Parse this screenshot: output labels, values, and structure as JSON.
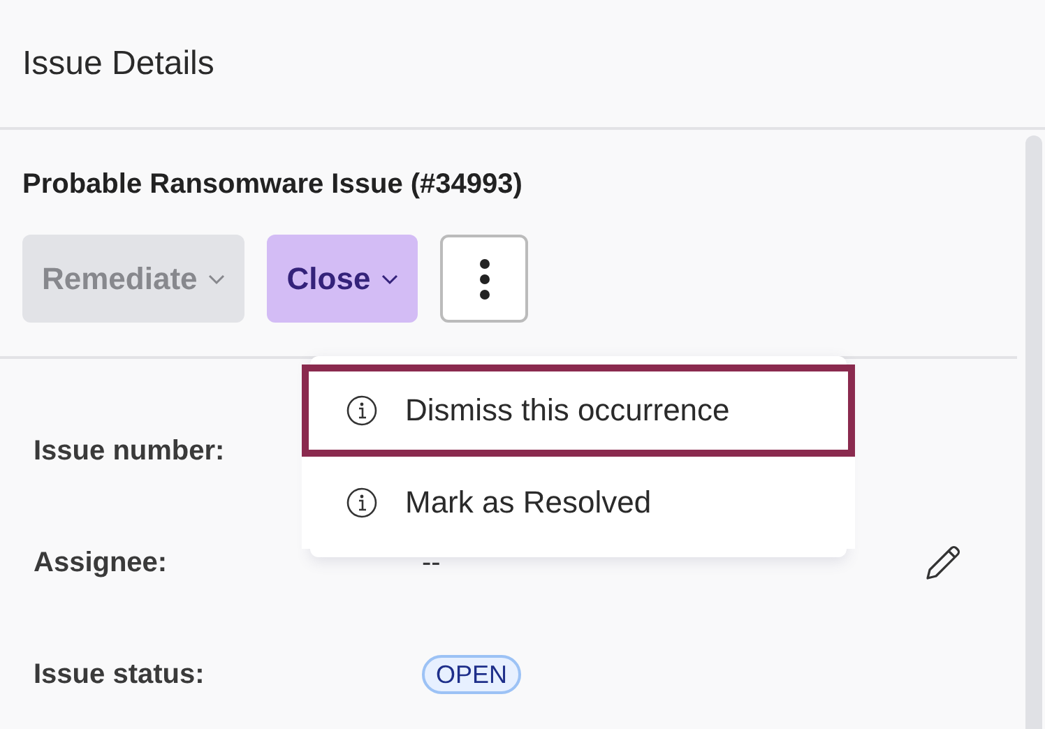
{
  "panel": {
    "title": "Issue Details"
  },
  "issue": {
    "title": "Probable Ransomware Issue (#34993)"
  },
  "actions": [
    {
      "kind": "dropdown",
      "label": "Remediate",
      "disabled": true
    },
    {
      "kind": "dropdown",
      "label": "Close",
      "disabled": false
    },
    {
      "kind": "more"
    }
  ],
  "menu": {
    "items": [
      {
        "label": "Dismiss this occurrence",
        "selected": true
      },
      {
        "label": "Mark as Resolved",
        "selected": false
      }
    ]
  },
  "fields": [
    {
      "label": "Issue number:"
    },
    {
      "kind": "text",
      "label": "Assignee:",
      "value": "--",
      "editable": true
    },
    {
      "kind": "badge",
      "label": "Issue status:",
      "value": "OPEN"
    }
  ]
}
